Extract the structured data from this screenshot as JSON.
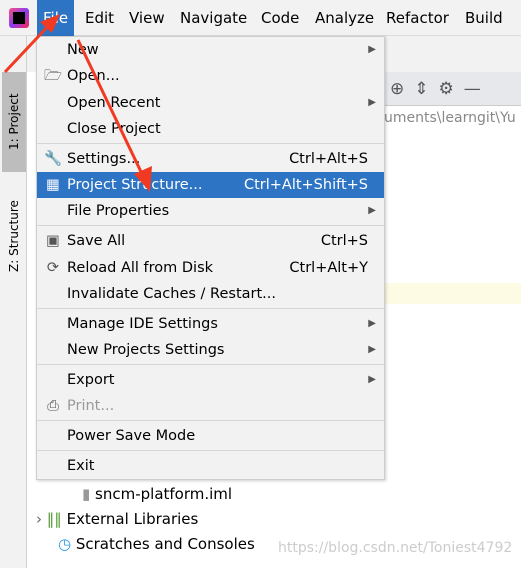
{
  "menubar": {
    "items": [
      "File",
      "Edit",
      "View",
      "Navigate",
      "Code",
      "Analyze",
      "Refactor",
      "Build"
    ],
    "active": "File"
  },
  "sidebar": {
    "tabs": [
      "1: Project",
      "Z: Structure"
    ]
  },
  "project_path": "uments\\learngit\\Yu",
  "file_menu": {
    "items": [
      {
        "label": "New",
        "submenu": true
      },
      {
        "label": "Open...",
        "icon": "folder-icon"
      },
      {
        "label": "Open Recent",
        "submenu": true
      },
      {
        "label": "Close Project"
      },
      {
        "label": "Settings...",
        "shortcut": "Ctrl+Alt+S",
        "icon": "wrench-icon"
      },
      {
        "label": "Project Structure...",
        "shortcut": "Ctrl+Alt+Shift+S",
        "icon": "project-structure-icon",
        "highlighted": true
      },
      {
        "label": "File Properties",
        "submenu": true
      },
      {
        "label": "Save All",
        "shortcut": "Ctrl+S",
        "icon": "save-icon"
      },
      {
        "label": "Reload All from Disk",
        "shortcut": "Ctrl+Alt+Y",
        "icon": "reload-icon"
      },
      {
        "label": "Invalidate Caches / Restart..."
      },
      {
        "label": "Manage IDE Settings",
        "submenu": true
      },
      {
        "label": "New Projects Settings",
        "submenu": true
      },
      {
        "label": "Export",
        "submenu": true
      },
      {
        "label": "Print...",
        "icon": "print-icon",
        "disabled": true
      },
      {
        "label": "Power Save Mode"
      },
      {
        "label": "Exit"
      }
    ]
  },
  "tree": {
    "items": [
      "sncm-platform.iml",
      "External Libraries",
      "Scratches and Consoles"
    ]
  },
  "watermark": "https://blog.csdn.net/Toniest4792",
  "colors": {
    "highlight": "#2d74c4",
    "annotation_arrow": "#f23a22"
  }
}
